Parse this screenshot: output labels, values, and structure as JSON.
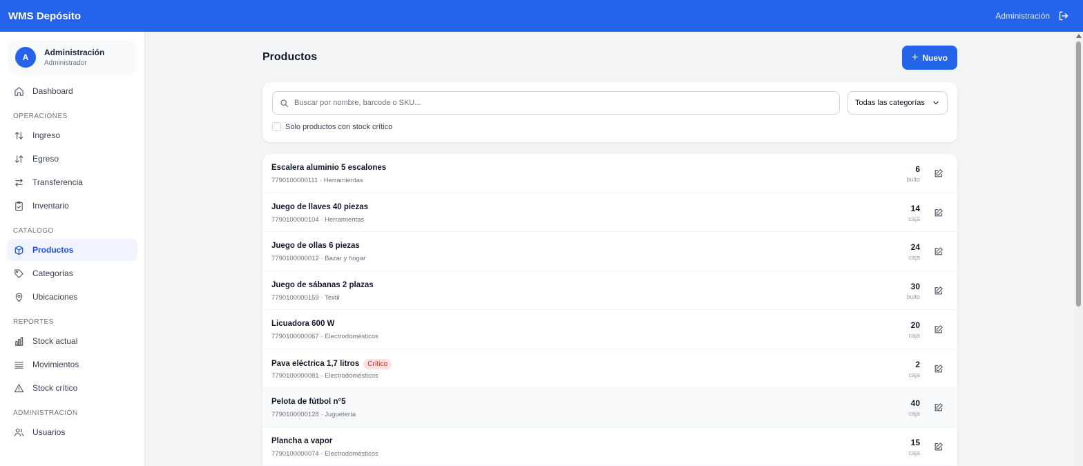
{
  "app": {
    "title": "WMS Depósito",
    "user_label": "Administración"
  },
  "sidebar": {
    "user": {
      "initial": "A",
      "name": "Administración",
      "role": "Administrador"
    },
    "dashboard": "Dashboard",
    "sections": {
      "operaciones": "OPERACIONES",
      "catalogo": "CATÁLOGO",
      "reportes": "REPORTES",
      "administracion": "ADMINISTRACIÓN"
    },
    "items": {
      "ingreso": "Ingreso",
      "egreso": "Egreso",
      "transferencia": "Transferencia",
      "inventario": "Inventario",
      "productos": "Productos",
      "categorias": "Categorías",
      "ubicaciones": "Ubicaciones",
      "stock_actual": "Stock actual",
      "movimientos": "Movimientos",
      "stock_critico": "Stock crítico",
      "usuarios": "Usuarios"
    }
  },
  "main": {
    "title": "Productos",
    "new_button": "Nuevo",
    "search_placeholder": "Buscar por nombre, barcode o SKU...",
    "category_select": "Todas las categorías",
    "critical_filter": "Solo productos con stock crítico",
    "critical_badge": "Crítico",
    "products": [
      {
        "name": "Escalera aluminio 5 escalones",
        "sub": "7790100000111 · Herramientas",
        "qty": "6",
        "unit": "bulto",
        "critical": false
      },
      {
        "name": "Juego de llaves 40 piezas",
        "sub": "7790100000104 · Herramientas",
        "qty": "14",
        "unit": "caja",
        "critical": false
      },
      {
        "name": "Juego de ollas 6 piezas",
        "sub": "7790100000012 · Bazar y hogar",
        "qty": "24",
        "unit": "caja",
        "critical": false
      },
      {
        "name": "Juego de sábanas 2 plazas",
        "sub": "7790100000159 · Textil",
        "qty": "30",
        "unit": "bulto",
        "critical": false
      },
      {
        "name": "Licuadora 600 W",
        "sub": "7790100000067 · Electrodomésticos",
        "qty": "20",
        "unit": "caja",
        "critical": false
      },
      {
        "name": "Pava eléctrica 1,7 litros",
        "sub": "7790100000081 · Electrodomésticos",
        "qty": "2",
        "unit": "caja",
        "critical": true
      },
      {
        "name": "Pelota de fútbol n°5",
        "sub": "7790100000128 · Juguetería",
        "qty": "40",
        "unit": "caja",
        "critical": false
      },
      {
        "name": "Plancha a vapor",
        "sub": "7790100000074 · Electrodomésticos",
        "qty": "15",
        "unit": "caja",
        "critical": false
      }
    ]
  },
  "colors": {
    "accent": "#2563eb",
    "critical": "#dc2626"
  }
}
